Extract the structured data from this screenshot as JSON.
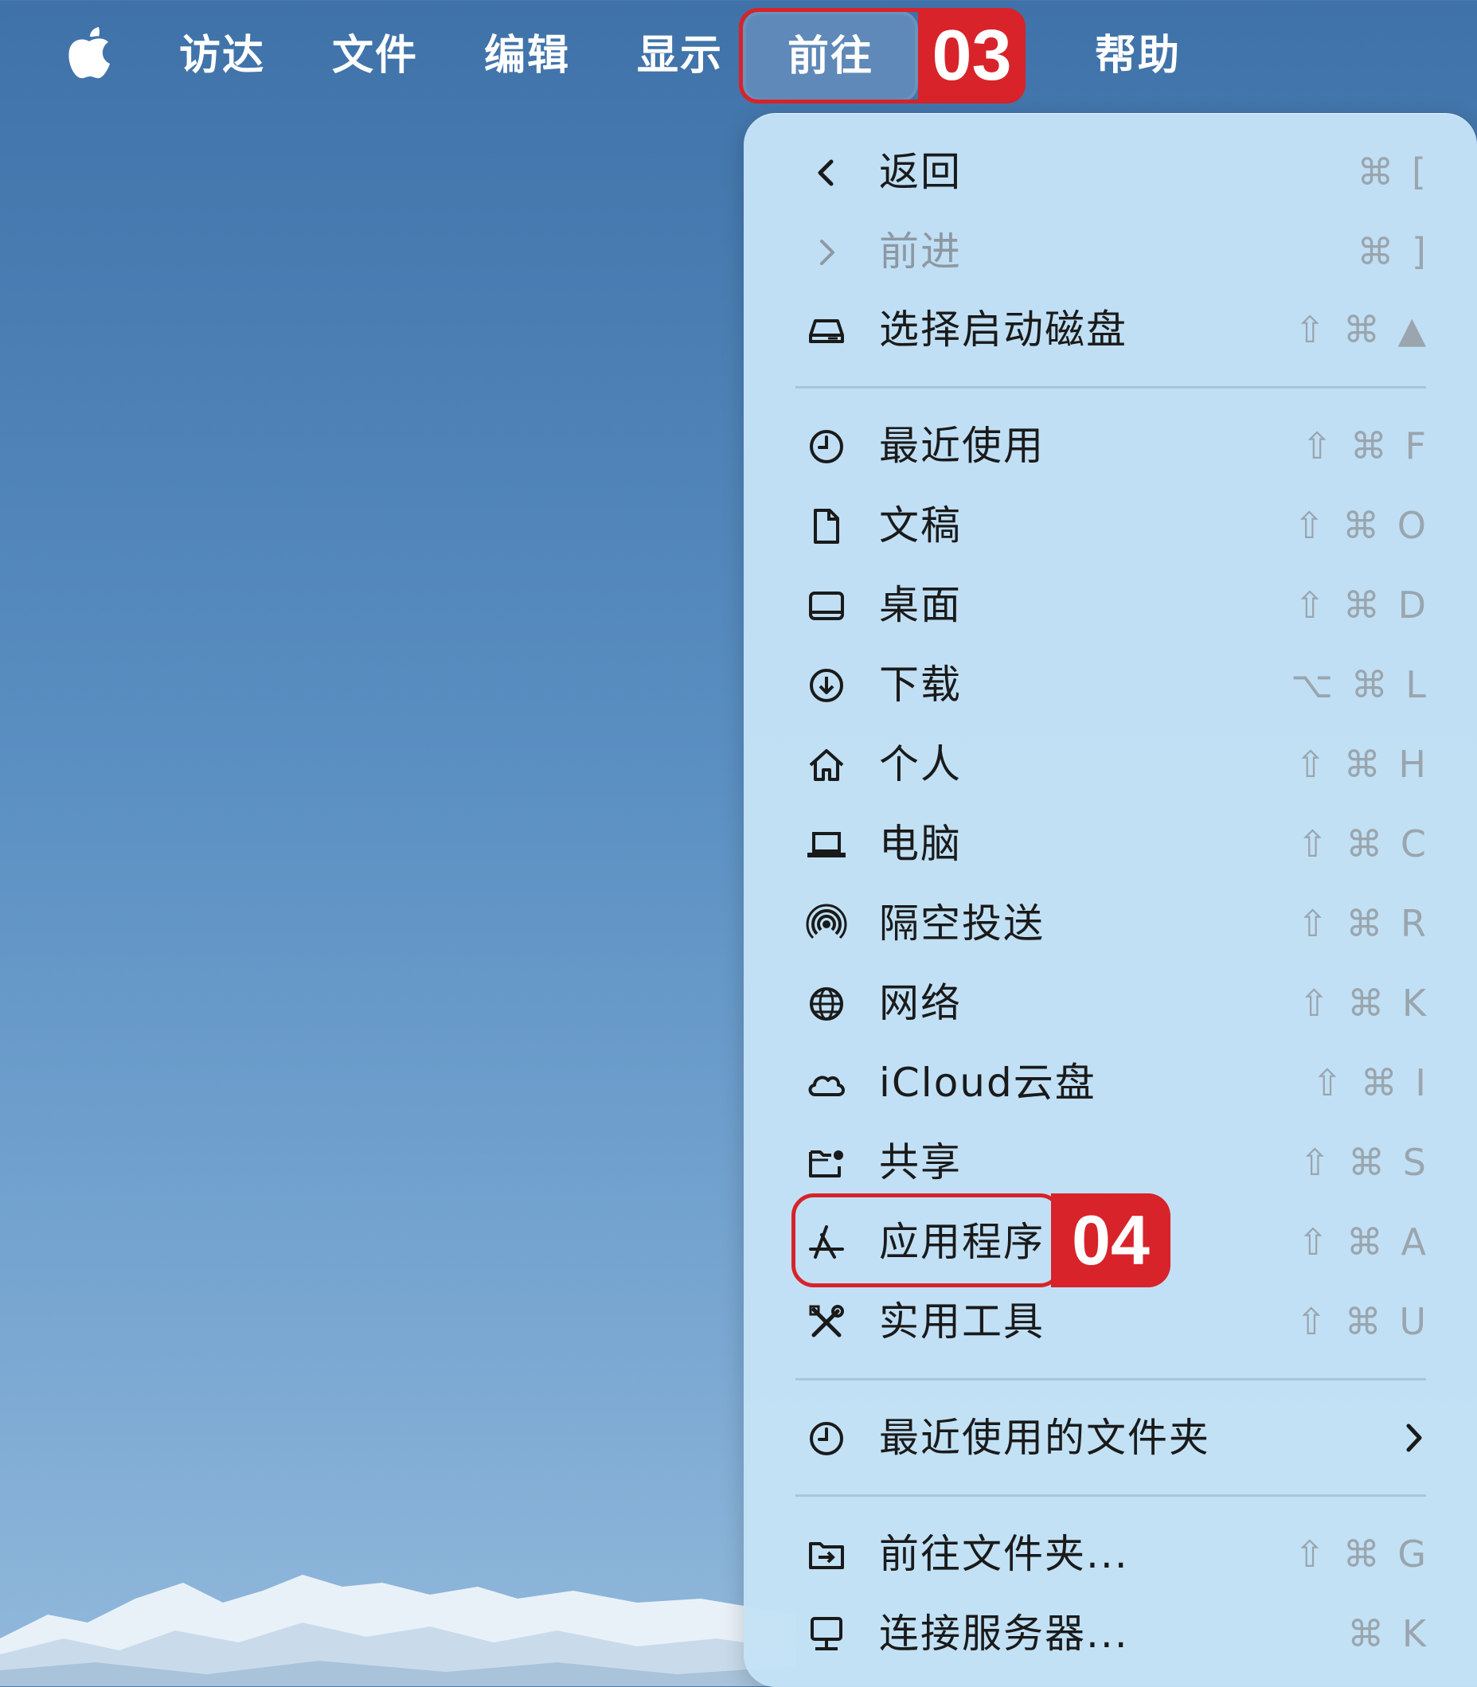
{
  "menubar": {
    "items": [
      "访达",
      "文件",
      "编辑",
      "显示",
      "前往",
      "帮助"
    ],
    "active": "前往",
    "annotation": "03"
  },
  "menu": {
    "annotation": "04",
    "groups": [
      [
        {
          "label": "返回",
          "shortcut": "⌘ [",
          "icon": "chevron-left-icon",
          "disabled": false
        },
        {
          "label": "前进",
          "shortcut": "⌘ ]",
          "icon": "chevron-right-icon",
          "disabled": true
        },
        {
          "label": "选择启动磁盘",
          "shortcut": "⇧ ⌘ ▲",
          "icon": "disk-icon",
          "disabled": false
        }
      ],
      [
        {
          "label": "最近使用",
          "shortcut": "⇧ ⌘ F",
          "icon": "clock-icon"
        },
        {
          "label": "文稿",
          "shortcut": "⇧ ⌘ O",
          "icon": "document-icon"
        },
        {
          "label": "桌面",
          "shortcut": "⇧ ⌘ D",
          "icon": "desktop-icon"
        },
        {
          "label": "下载",
          "shortcut": "⌥ ⌘ L",
          "icon": "download-icon"
        },
        {
          "label": "个人",
          "shortcut": "⇧ ⌘ H",
          "icon": "home-icon"
        },
        {
          "label": "电脑",
          "shortcut": "⇧ ⌘ C",
          "icon": "laptop-icon"
        },
        {
          "label": "隔空投送",
          "shortcut": "⇧ ⌘ R",
          "icon": "airdrop-icon"
        },
        {
          "label": "网络",
          "shortcut": "⇧ ⌘ K",
          "icon": "globe-icon"
        },
        {
          "label": "iCloud云盘",
          "shortcut": "⇧ ⌘ I",
          "icon": "cloud-icon"
        },
        {
          "label": "共享",
          "shortcut": "⇧ ⌘ S",
          "icon": "shared-folder-icon"
        },
        {
          "label": "应用程序",
          "shortcut": "⇧ ⌘ A",
          "icon": "app-store-icon"
        },
        {
          "label": "实用工具",
          "shortcut": "⇧ ⌘ U",
          "icon": "tools-icon"
        }
      ],
      [
        {
          "label": "最近使用的文件夹",
          "icon": "clock-icon",
          "submenu": true
        }
      ],
      [
        {
          "label": "前往文件夹...",
          "shortcut": "⇧ ⌘ G",
          "icon": "go-folder-icon"
        },
        {
          "label": "连接服务器...",
          "shortcut": "⌘ K",
          "icon": "server-icon"
        }
      ]
    ]
  },
  "colors": {
    "annotation_red": "#d8232a",
    "menu_bg": "#c4e2f6",
    "menubar_text": "#ffffff"
  }
}
